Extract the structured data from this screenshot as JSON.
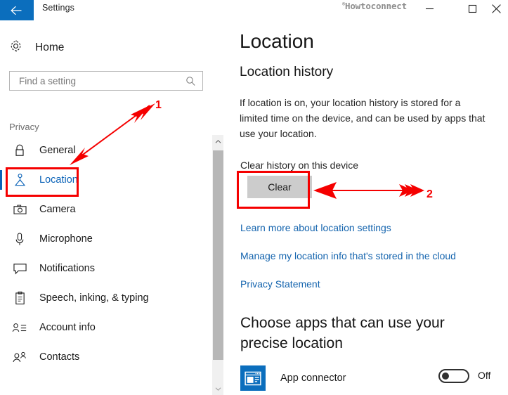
{
  "window": {
    "title": "Settings",
    "watermark_symbol": "®",
    "watermark": "Howtoconnect",
    "back_icon": "back-arrow-icon",
    "minimize_label": "—",
    "maximize_label": "□",
    "close_label": "✕"
  },
  "sidebar": {
    "home": {
      "label": "Home",
      "icon": "gear-icon"
    },
    "search": {
      "placeholder": "Find a setting",
      "value": "",
      "icon": "search-icon"
    },
    "group_title": "Privacy",
    "items": [
      {
        "label": "General",
        "icon": "lock-icon",
        "selected": false
      },
      {
        "label": "Location",
        "icon": "location-pin-icon",
        "selected": true
      },
      {
        "label": "Camera",
        "icon": "camera-icon",
        "selected": false
      },
      {
        "label": "Microphone",
        "icon": "microphone-icon",
        "selected": false
      },
      {
        "label": "Notifications",
        "icon": "speech-bubble-icon",
        "selected": false
      },
      {
        "label": "Speech, inking, & typing",
        "icon": "clipboard-icon",
        "selected": false
      },
      {
        "label": "Account info",
        "icon": "account-list-icon",
        "selected": false
      },
      {
        "label": "Contacts",
        "icon": "contacts-icon",
        "selected": false
      }
    ],
    "scrollbar": {
      "up_icon": "chevron-up-icon",
      "down_icon": "chevron-down-icon"
    }
  },
  "main": {
    "page_title": "Location",
    "section_title": "Location history",
    "description": "If location is on, your location history is stored for a limited time on the device, and can be used by apps that use your location.",
    "clear_label": "Clear history on this device",
    "clear_button": "Clear",
    "links": [
      "Learn more about location settings",
      "Manage my location info that's stored in the cloud",
      "Privacy Statement"
    ],
    "apps_heading": "Choose apps that can use your precise location",
    "apps": [
      {
        "name": "App connector",
        "icon": "app-connector-icon",
        "toggle_state": "Off",
        "toggle_on": false
      }
    ]
  },
  "annotations": {
    "accent_color": "#f50000",
    "markers": [
      {
        "number": "1",
        "target": "sidebar-item-location"
      },
      {
        "number": "2",
        "target": "clear-button"
      }
    ]
  },
  "colors": {
    "accent_blue": "#0b6ebd",
    "link_blue": "#1464ae",
    "selected_blue": "#0b63b8",
    "button_gray": "#cccccc",
    "annotation_red": "#f50000"
  }
}
